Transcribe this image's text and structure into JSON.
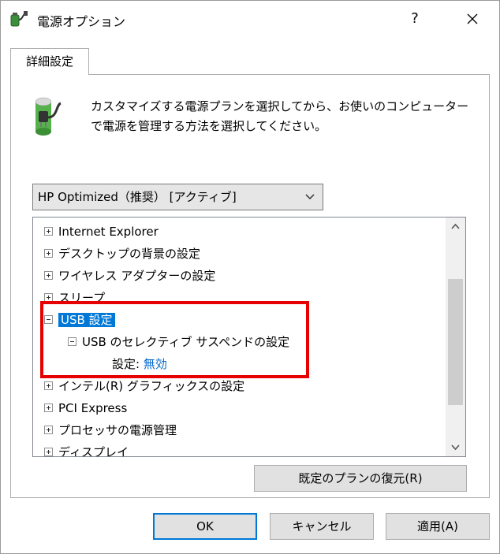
{
  "window": {
    "title": "電源オプション",
    "help_label": "?",
    "close_label": "✕"
  },
  "tab": {
    "label": "詳細設定"
  },
  "description": "カスタマイズする電源プランを選択してから、お使いのコンピューターで電源を管理する方法を選択してください。",
  "plan_select": {
    "value": "HP Optimized（推奨） [アクティブ]"
  },
  "tree": {
    "items": [
      {
        "label": "Internet Explorer",
        "expander": "plus"
      },
      {
        "label": "デスクトップの背景の設定",
        "expander": "plus"
      },
      {
        "label": "ワイヤレス アダプターの設定",
        "expander": "plus"
      },
      {
        "label": "スリープ",
        "expander": "plus"
      },
      {
        "label": "USB 設定",
        "expander": "minus",
        "selected": true
      },
      {
        "label": "USB のセレクティブ サスペンドの設定",
        "expander": "minus",
        "level": 2
      },
      {
        "setting_label": "設定:",
        "setting_value": "無効",
        "level": 3
      },
      {
        "label": "インテル(R) グラフィックスの設定",
        "expander": "plus"
      },
      {
        "label": "PCI Express",
        "expander": "plus"
      },
      {
        "label": "プロセッサの電源管理",
        "expander": "plus"
      },
      {
        "label": "ディスプレイ",
        "expander": "plus"
      }
    ]
  },
  "buttons": {
    "restore_label": "既定のプランの復元(R)",
    "ok_label": "OK",
    "cancel_label": "キャンセル",
    "apply_label": "適用(A)"
  },
  "colors": {
    "selection": "#0078d7",
    "highlight_box": "#e60000",
    "link": "#0066cc"
  }
}
